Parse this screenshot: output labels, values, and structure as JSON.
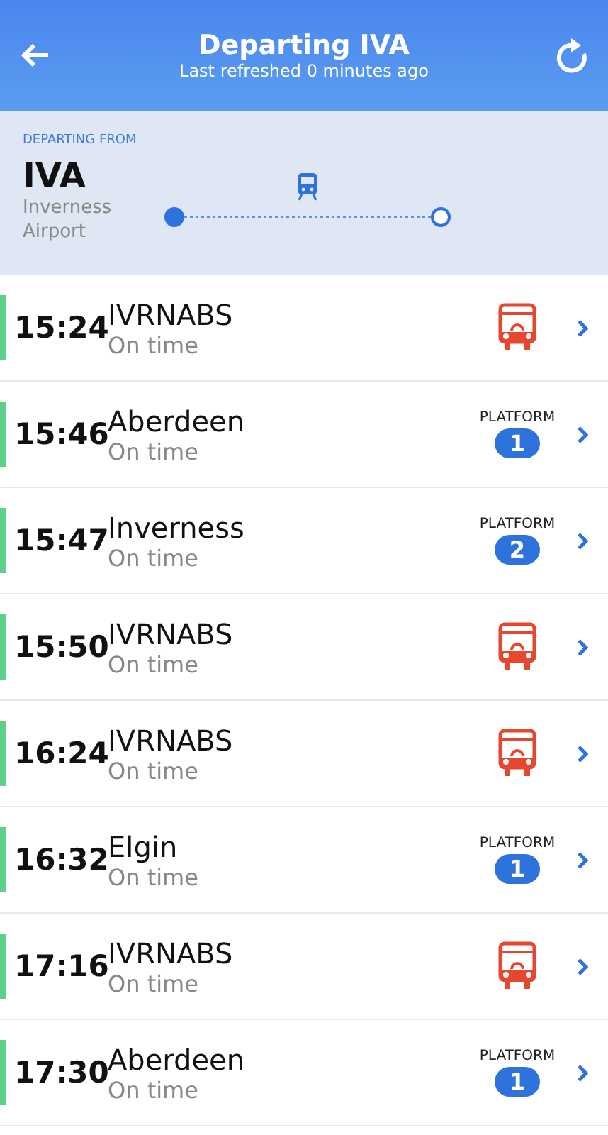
{
  "header": {
    "title": "Departing IVA",
    "subtitle": "Last refreshed 0 minutes ago"
  },
  "origin": {
    "label": "DEPARTING FROM",
    "code": "IVA",
    "name": "Inverness Airport"
  },
  "departures": [
    {
      "time": "15:24",
      "destination": "IVRNABS",
      "status": "On time",
      "kind": "bus"
    },
    {
      "time": "15:46",
      "destination": "Aberdeen",
      "status": "On time",
      "kind": "platform",
      "platform_label": "PLATFORM",
      "platform": "1"
    },
    {
      "time": "15:47",
      "destination": "Inverness",
      "status": "On time",
      "kind": "platform",
      "platform_label": "PLATFORM",
      "platform": "2"
    },
    {
      "time": "15:50",
      "destination": "IVRNABS",
      "status": "On time",
      "kind": "bus"
    },
    {
      "time": "16:24",
      "destination": "IVRNABS",
      "status": "On time",
      "kind": "bus"
    },
    {
      "time": "16:32",
      "destination": "Elgin",
      "status": "On time",
      "kind": "platform",
      "platform_label": "PLATFORM",
      "platform": "1"
    },
    {
      "time": "17:16",
      "destination": "IVRNABS",
      "status": "On time",
      "kind": "bus"
    },
    {
      "time": "17:30",
      "destination": "Aberdeen",
      "status": "On time",
      "kind": "platform",
      "platform_label": "PLATFORM",
      "platform": "1"
    }
  ]
}
